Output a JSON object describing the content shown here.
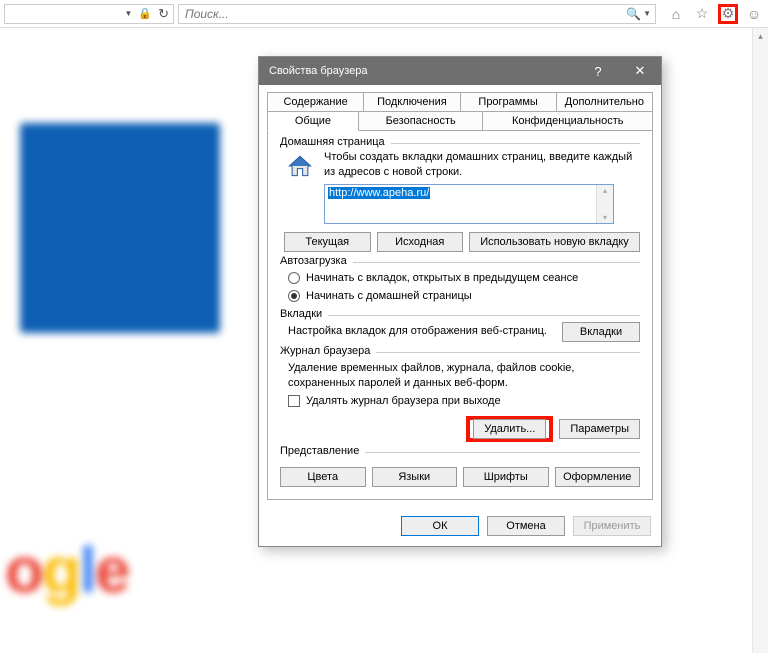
{
  "toolbar": {
    "search_placeholder": "Поиск..."
  },
  "dialog": {
    "title": "Свойства браузера",
    "tabs_row1": {
      "content": "Содержание",
      "connections": "Подключения",
      "programs": "Программы",
      "advanced": "Дополнительно"
    },
    "tabs_row2": {
      "general": "Общие",
      "security": "Безопасность",
      "privacy": "Конфиденциальность"
    },
    "home": {
      "legend": "Домашняя страница",
      "description": "Чтобы создать вкладки домашних страниц, введите каждый из адресов с новой строки.",
      "url": "http://www.apeha.ru/",
      "btn_current": "Текущая",
      "btn_default": "Исходная",
      "btn_newtab": "Использовать новую вкладку"
    },
    "startup": {
      "legend": "Автозагрузка",
      "opt_tabs": "Начинать с вкладок, открытых в предыдущем сеансе",
      "opt_home": "Начинать с домашней страницы"
    },
    "tabs_section": {
      "legend": "Вкладки",
      "description": "Настройка вкладок для отображения веб-страниц.",
      "btn": "Вкладки"
    },
    "history": {
      "legend": "Журнал браузера",
      "description": "Удаление временных файлов, журнала, файлов cookie, сохраненных паролей и данных веб-форм.",
      "checkbox": "Удалять журнал браузера при выходе",
      "btn_delete": "Удалить...",
      "btn_settings": "Параметры"
    },
    "appearance": {
      "legend": "Представление",
      "btn_colors": "Цвета",
      "btn_languages": "Языки",
      "btn_fonts": "Шрифты",
      "btn_accessibility": "Оформление"
    },
    "footer": {
      "ok": "ОК",
      "cancel": "Отмена",
      "apply": "Применить"
    }
  }
}
